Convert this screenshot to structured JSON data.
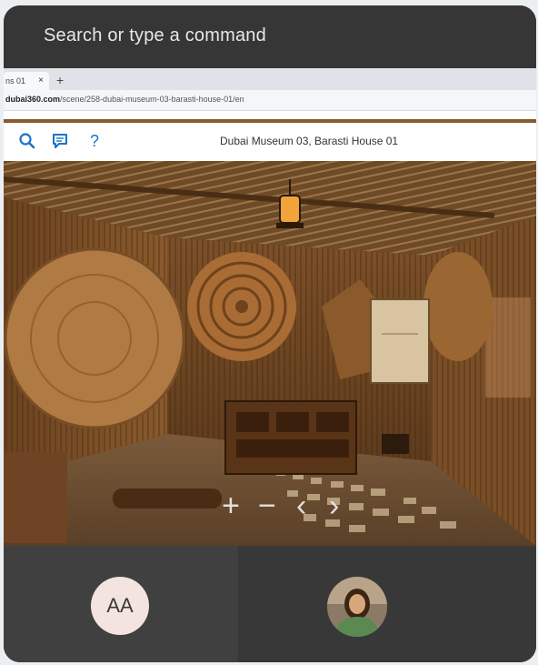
{
  "command_bar": {
    "placeholder": "Search or type a command"
  },
  "browser": {
    "tab": {
      "title": "ns 01",
      "close": "×"
    },
    "new_tab": "+",
    "url": {
      "host": "dubai360.com",
      "path": "/scene/258-dubai-museum-03-barasti-house-01/en"
    }
  },
  "tour": {
    "title": "Dubai Museum 03, Barasti House 01",
    "toolbar": [
      "search-icon",
      "chat-icon",
      "help-icon"
    ],
    "help_label": "?",
    "controls": {
      "zoom_in": "+",
      "zoom_out": "−",
      "prev": "‹",
      "next": "›"
    }
  },
  "participants": [
    {
      "initials": "AA"
    },
    {
      "kind": "photo"
    }
  ],
  "colors": {
    "frame": "#3a3a3a",
    "accent": "#1a73c8",
    "tour_border": "#8a5a2e"
  }
}
